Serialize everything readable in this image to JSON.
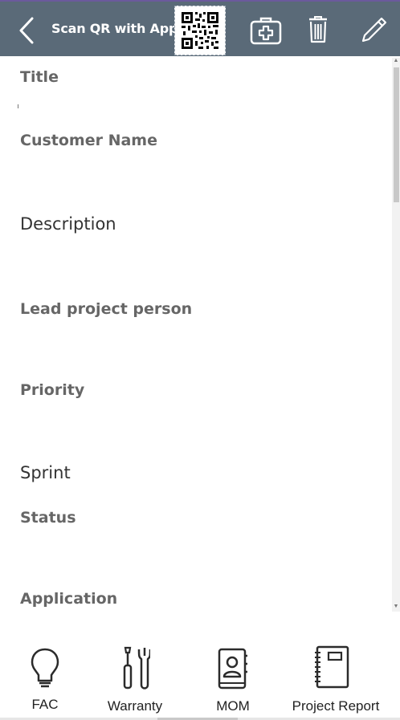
{
  "header": {
    "title": "Scan QR with App",
    "icons": [
      "back-chevron-icon",
      "qr-code-icon",
      "medical-kit-icon",
      "trash-icon",
      "pencil-icon"
    ],
    "bg_color": "#5a6a78"
  },
  "fields": [
    {
      "label": "Title"
    },
    {
      "label": "Customer Name"
    },
    {
      "label": "Description"
    },
    {
      "label": "Lead project person"
    },
    {
      "label": "Priority"
    },
    {
      "label": "Sprint"
    },
    {
      "label": "Status"
    },
    {
      "label": "Application"
    }
  ],
  "bottom_nav": [
    {
      "label": "FAC",
      "icon": "lightbulb-icon"
    },
    {
      "label": "Warranty",
      "icon": "tools-icon"
    },
    {
      "label": "MOM",
      "icon": "contact-book-icon"
    },
    {
      "label": "Project Report",
      "icon": "notebook-icon"
    }
  ]
}
